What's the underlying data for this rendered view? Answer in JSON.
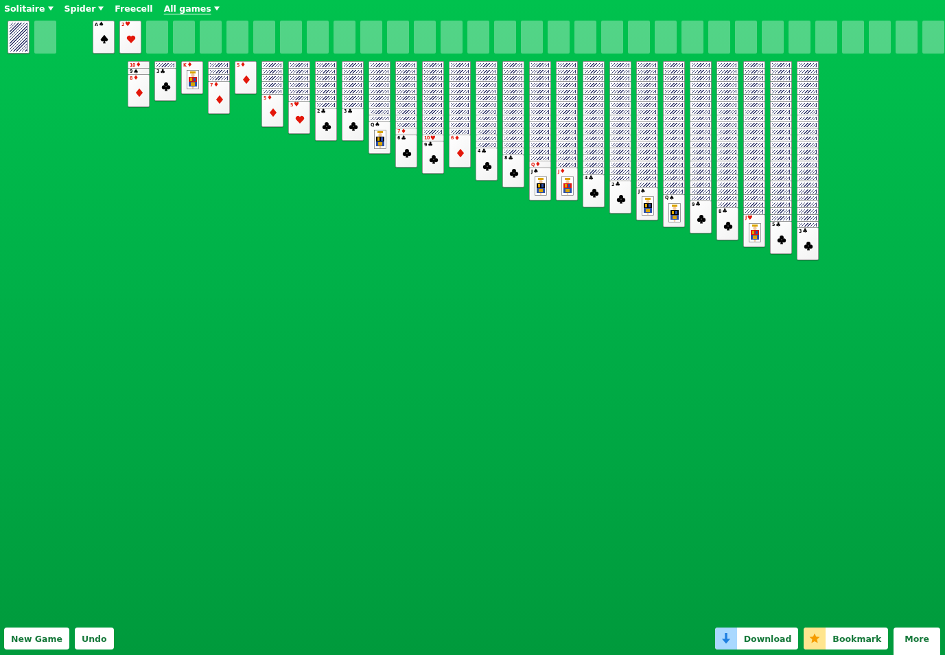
{
  "nav": [
    {
      "label": "Solitaire",
      "has_menu": true,
      "selected": false
    },
    {
      "label": "Spider",
      "has_menu": true,
      "selected": false
    },
    {
      "label": "Freecell",
      "has_menu": false,
      "selected": false
    },
    {
      "label": "All games",
      "has_menu": true,
      "selected": true
    }
  ],
  "stock": [
    {
      "kind": "back"
    },
    {
      "kind": "empty"
    }
  ],
  "foundations": [
    {
      "kind": "spade",
      "rank": "A",
      "suit": "♠",
      "color": "#000000"
    },
    {
      "kind": "heart",
      "rank": "2",
      "suit": "♥",
      "color": "#e3170a"
    },
    {
      "kind": "empty"
    },
    {
      "kind": "empty"
    },
    {
      "kind": "empty"
    },
    {
      "kind": "empty"
    },
    {
      "kind": "empty"
    },
    {
      "kind": "empty"
    },
    {
      "kind": "empty"
    },
    {
      "kind": "empty"
    },
    {
      "kind": "empty"
    },
    {
      "kind": "empty"
    },
    {
      "kind": "empty"
    },
    {
      "kind": "empty"
    },
    {
      "kind": "empty"
    },
    {
      "kind": "empty"
    },
    {
      "kind": "empty"
    },
    {
      "kind": "empty"
    },
    {
      "kind": "empty"
    },
    {
      "kind": "empty"
    },
    {
      "kind": "empty"
    },
    {
      "kind": "empty"
    },
    {
      "kind": "empty"
    },
    {
      "kind": "empty"
    },
    {
      "kind": "empty"
    },
    {
      "kind": "empty"
    },
    {
      "kind": "empty"
    },
    {
      "kind": "empty"
    },
    {
      "kind": "empty"
    },
    {
      "kind": "empty"
    },
    {
      "kind": "empty"
    },
    {
      "kind": "empty"
    }
  ],
  "tableau": [
    {
      "cards": [
        {
          "kind": "diamond",
          "rank": "10",
          "suit": "♦",
          "color": "#e3170a"
        },
        {
          "kind": "spade",
          "rank": "9",
          "suit": "♠",
          "color": "#000000"
        },
        {
          "kind": "diamond",
          "rank": "8",
          "suit": "♦",
          "color": "#e3170a"
        }
      ]
    },
    {
      "cards": [
        {
          "kind": "back"
        },
        {
          "kind": "club",
          "rank": "3",
          "suit": "♣",
          "color": "#000000"
        }
      ]
    },
    {
      "cards": [
        {
          "kind": "court",
          "rank": "K",
          "suit": "♦",
          "color": "#e3170a"
        }
      ]
    },
    {
      "cards": [
        {
          "kind": "back"
        },
        {
          "kind": "back"
        },
        {
          "kind": "back"
        },
        {
          "kind": "diamond",
          "rank": "7",
          "suit": "♦",
          "color": "#e3170a"
        }
      ]
    },
    {
      "cards": [
        {
          "kind": "diamond",
          "rank": "5",
          "suit": "♦",
          "color": "#e3170a"
        }
      ]
    },
    {
      "cards": [
        {
          "kind": "back"
        },
        {
          "kind": "back"
        },
        {
          "kind": "back"
        },
        {
          "kind": "back"
        },
        {
          "kind": "back"
        },
        {
          "kind": "diamond",
          "rank": "5",
          "suit": "♦",
          "color": "#e3170a"
        }
      ]
    },
    {
      "cards": [
        {
          "kind": "back"
        },
        {
          "kind": "back"
        },
        {
          "kind": "back"
        },
        {
          "kind": "back"
        },
        {
          "kind": "back"
        },
        {
          "kind": "back"
        },
        {
          "kind": "heart",
          "rank": "5",
          "suit": "♥",
          "color": "#e3170a"
        }
      ]
    },
    {
      "cards": [
        {
          "kind": "back"
        },
        {
          "kind": "back"
        },
        {
          "kind": "back"
        },
        {
          "kind": "back"
        },
        {
          "kind": "back"
        },
        {
          "kind": "back"
        },
        {
          "kind": "back"
        },
        {
          "kind": "club",
          "rank": "2",
          "suit": "♣",
          "color": "#000000"
        }
      ]
    },
    {
      "cards": [
        {
          "kind": "back"
        },
        {
          "kind": "back"
        },
        {
          "kind": "back"
        },
        {
          "kind": "back"
        },
        {
          "kind": "back"
        },
        {
          "kind": "back"
        },
        {
          "kind": "back"
        },
        {
          "kind": "club",
          "rank": "3",
          "suit": "♣",
          "color": "#000000"
        }
      ]
    },
    {
      "cards": [
        {
          "kind": "back"
        },
        {
          "kind": "back"
        },
        {
          "kind": "back"
        },
        {
          "kind": "back"
        },
        {
          "kind": "back"
        },
        {
          "kind": "back"
        },
        {
          "kind": "back"
        },
        {
          "kind": "back"
        },
        {
          "kind": "back"
        },
        {
          "kind": "court",
          "rank": "Q",
          "suit": "♠",
          "color": "#000000"
        }
      ]
    },
    {
      "cards": [
        {
          "kind": "back"
        },
        {
          "kind": "back"
        },
        {
          "kind": "back"
        },
        {
          "kind": "back"
        },
        {
          "kind": "back"
        },
        {
          "kind": "back"
        },
        {
          "kind": "back"
        },
        {
          "kind": "back"
        },
        {
          "kind": "back"
        },
        {
          "kind": "back"
        },
        {
          "kind": "diamond",
          "rank": "7",
          "suit": "♦",
          "color": "#e3170a"
        },
        {
          "kind": "club",
          "rank": "6",
          "suit": "♣",
          "color": "#000000"
        }
      ]
    },
    {
      "cards": [
        {
          "kind": "back"
        },
        {
          "kind": "back"
        },
        {
          "kind": "back"
        },
        {
          "kind": "back"
        },
        {
          "kind": "back"
        },
        {
          "kind": "back"
        },
        {
          "kind": "back"
        },
        {
          "kind": "back"
        },
        {
          "kind": "back"
        },
        {
          "kind": "back"
        },
        {
          "kind": "back"
        },
        {
          "kind": "heart",
          "rank": "10",
          "suit": "♥",
          "color": "#e3170a"
        },
        {
          "kind": "club",
          "rank": "9",
          "suit": "♣",
          "color": "#000000"
        }
      ]
    },
    {
      "cards": [
        {
          "kind": "back"
        },
        {
          "kind": "back"
        },
        {
          "kind": "back"
        },
        {
          "kind": "back"
        },
        {
          "kind": "back"
        },
        {
          "kind": "back"
        },
        {
          "kind": "back"
        },
        {
          "kind": "back"
        },
        {
          "kind": "back"
        },
        {
          "kind": "back"
        },
        {
          "kind": "back"
        },
        {
          "kind": "diamond",
          "rank": "6",
          "suit": "♦",
          "color": "#e3170a"
        }
      ]
    },
    {
      "cards": [
        {
          "kind": "back"
        },
        {
          "kind": "back"
        },
        {
          "kind": "back"
        },
        {
          "kind": "back"
        },
        {
          "kind": "back"
        },
        {
          "kind": "back"
        },
        {
          "kind": "back"
        },
        {
          "kind": "back"
        },
        {
          "kind": "back"
        },
        {
          "kind": "back"
        },
        {
          "kind": "back"
        },
        {
          "kind": "back"
        },
        {
          "kind": "back"
        },
        {
          "kind": "club",
          "rank": "4",
          "suit": "♣",
          "color": "#000000"
        }
      ]
    },
    {
      "cards": [
        {
          "kind": "back"
        },
        {
          "kind": "back"
        },
        {
          "kind": "back"
        },
        {
          "kind": "back"
        },
        {
          "kind": "back"
        },
        {
          "kind": "back"
        },
        {
          "kind": "back"
        },
        {
          "kind": "back"
        },
        {
          "kind": "back"
        },
        {
          "kind": "back"
        },
        {
          "kind": "back"
        },
        {
          "kind": "back"
        },
        {
          "kind": "back"
        },
        {
          "kind": "back"
        },
        {
          "kind": "club",
          "rank": "8",
          "suit": "♣",
          "color": "#000000"
        }
      ]
    },
    {
      "cards": [
        {
          "kind": "back"
        },
        {
          "kind": "back"
        },
        {
          "kind": "back"
        },
        {
          "kind": "back"
        },
        {
          "kind": "back"
        },
        {
          "kind": "back"
        },
        {
          "kind": "back"
        },
        {
          "kind": "back"
        },
        {
          "kind": "back"
        },
        {
          "kind": "back"
        },
        {
          "kind": "back"
        },
        {
          "kind": "back"
        },
        {
          "kind": "back"
        },
        {
          "kind": "back"
        },
        {
          "kind": "back"
        },
        {
          "kind": "diamond",
          "rank": "Q",
          "suit": "♦",
          "color": "#e3170a"
        },
        {
          "kind": "court",
          "rank": "J",
          "suit": "♠",
          "color": "#000000"
        }
      ]
    },
    {
      "cards": [
        {
          "kind": "back"
        },
        {
          "kind": "back"
        },
        {
          "kind": "back"
        },
        {
          "kind": "back"
        },
        {
          "kind": "back"
        },
        {
          "kind": "back"
        },
        {
          "kind": "back"
        },
        {
          "kind": "back"
        },
        {
          "kind": "back"
        },
        {
          "kind": "back"
        },
        {
          "kind": "back"
        },
        {
          "kind": "back"
        },
        {
          "kind": "back"
        },
        {
          "kind": "back"
        },
        {
          "kind": "back"
        },
        {
          "kind": "back"
        },
        {
          "kind": "court",
          "rank": "J",
          "suit": "♦",
          "color": "#e3170a"
        }
      ]
    },
    {
      "cards": [
        {
          "kind": "back"
        },
        {
          "kind": "back"
        },
        {
          "kind": "back"
        },
        {
          "kind": "back"
        },
        {
          "kind": "back"
        },
        {
          "kind": "back"
        },
        {
          "kind": "back"
        },
        {
          "kind": "back"
        },
        {
          "kind": "back"
        },
        {
          "kind": "back"
        },
        {
          "kind": "back"
        },
        {
          "kind": "back"
        },
        {
          "kind": "back"
        },
        {
          "kind": "back"
        },
        {
          "kind": "back"
        },
        {
          "kind": "back"
        },
        {
          "kind": "back"
        },
        {
          "kind": "club",
          "rank": "4",
          "suit": "♣",
          "color": "#000000"
        }
      ]
    },
    {
      "cards": [
        {
          "kind": "back"
        },
        {
          "kind": "back"
        },
        {
          "kind": "back"
        },
        {
          "kind": "back"
        },
        {
          "kind": "back"
        },
        {
          "kind": "back"
        },
        {
          "kind": "back"
        },
        {
          "kind": "back"
        },
        {
          "kind": "back"
        },
        {
          "kind": "back"
        },
        {
          "kind": "back"
        },
        {
          "kind": "back"
        },
        {
          "kind": "back"
        },
        {
          "kind": "back"
        },
        {
          "kind": "back"
        },
        {
          "kind": "back"
        },
        {
          "kind": "back"
        },
        {
          "kind": "back"
        },
        {
          "kind": "club",
          "rank": "2",
          "suit": "♣",
          "color": "#000000"
        }
      ]
    },
    {
      "cards": [
        {
          "kind": "back"
        },
        {
          "kind": "back"
        },
        {
          "kind": "back"
        },
        {
          "kind": "back"
        },
        {
          "kind": "back"
        },
        {
          "kind": "back"
        },
        {
          "kind": "back"
        },
        {
          "kind": "back"
        },
        {
          "kind": "back"
        },
        {
          "kind": "back"
        },
        {
          "kind": "back"
        },
        {
          "kind": "back"
        },
        {
          "kind": "back"
        },
        {
          "kind": "back"
        },
        {
          "kind": "back"
        },
        {
          "kind": "back"
        },
        {
          "kind": "back"
        },
        {
          "kind": "back"
        },
        {
          "kind": "back"
        },
        {
          "kind": "court",
          "rank": "J",
          "suit": "♠",
          "color": "#000000"
        }
      ]
    },
    {
      "cards": [
        {
          "kind": "back"
        },
        {
          "kind": "back"
        },
        {
          "kind": "back"
        },
        {
          "kind": "back"
        },
        {
          "kind": "back"
        },
        {
          "kind": "back"
        },
        {
          "kind": "back"
        },
        {
          "kind": "back"
        },
        {
          "kind": "back"
        },
        {
          "kind": "back"
        },
        {
          "kind": "back"
        },
        {
          "kind": "back"
        },
        {
          "kind": "back"
        },
        {
          "kind": "back"
        },
        {
          "kind": "back"
        },
        {
          "kind": "back"
        },
        {
          "kind": "back"
        },
        {
          "kind": "back"
        },
        {
          "kind": "back"
        },
        {
          "kind": "back"
        },
        {
          "kind": "court",
          "rank": "Q",
          "suit": "♠",
          "color": "#000000"
        }
      ]
    },
    {
      "cards": [
        {
          "kind": "back"
        },
        {
          "kind": "back"
        },
        {
          "kind": "back"
        },
        {
          "kind": "back"
        },
        {
          "kind": "back"
        },
        {
          "kind": "back"
        },
        {
          "kind": "back"
        },
        {
          "kind": "back"
        },
        {
          "kind": "back"
        },
        {
          "kind": "back"
        },
        {
          "kind": "back"
        },
        {
          "kind": "back"
        },
        {
          "kind": "back"
        },
        {
          "kind": "back"
        },
        {
          "kind": "back"
        },
        {
          "kind": "back"
        },
        {
          "kind": "back"
        },
        {
          "kind": "back"
        },
        {
          "kind": "back"
        },
        {
          "kind": "back"
        },
        {
          "kind": "back"
        },
        {
          "kind": "club",
          "rank": "9",
          "suit": "♣",
          "color": "#000000"
        }
      ]
    },
    {
      "cards": [
        {
          "kind": "back"
        },
        {
          "kind": "back"
        },
        {
          "kind": "back"
        },
        {
          "kind": "back"
        },
        {
          "kind": "back"
        },
        {
          "kind": "back"
        },
        {
          "kind": "back"
        },
        {
          "kind": "back"
        },
        {
          "kind": "back"
        },
        {
          "kind": "back"
        },
        {
          "kind": "back"
        },
        {
          "kind": "back"
        },
        {
          "kind": "back"
        },
        {
          "kind": "back"
        },
        {
          "kind": "back"
        },
        {
          "kind": "back"
        },
        {
          "kind": "back"
        },
        {
          "kind": "back"
        },
        {
          "kind": "back"
        },
        {
          "kind": "back"
        },
        {
          "kind": "back"
        },
        {
          "kind": "back"
        },
        {
          "kind": "club",
          "rank": "8",
          "suit": "♣",
          "color": "#000000"
        }
      ]
    },
    {
      "cards": [
        {
          "kind": "back"
        },
        {
          "kind": "back"
        },
        {
          "kind": "back"
        },
        {
          "kind": "back"
        },
        {
          "kind": "back"
        },
        {
          "kind": "back"
        },
        {
          "kind": "back"
        },
        {
          "kind": "back"
        },
        {
          "kind": "back"
        },
        {
          "kind": "back"
        },
        {
          "kind": "back"
        },
        {
          "kind": "back"
        },
        {
          "kind": "back"
        },
        {
          "kind": "back"
        },
        {
          "kind": "back"
        },
        {
          "kind": "back"
        },
        {
          "kind": "back"
        },
        {
          "kind": "back"
        },
        {
          "kind": "back"
        },
        {
          "kind": "back"
        },
        {
          "kind": "back"
        },
        {
          "kind": "back"
        },
        {
          "kind": "back"
        },
        {
          "kind": "court",
          "rank": "J",
          "suit": "♥",
          "color": "#e3170a"
        }
      ]
    },
    {
      "cards": [
        {
          "kind": "back"
        },
        {
          "kind": "back"
        },
        {
          "kind": "back"
        },
        {
          "kind": "back"
        },
        {
          "kind": "back"
        },
        {
          "kind": "back"
        },
        {
          "kind": "back"
        },
        {
          "kind": "back"
        },
        {
          "kind": "back"
        },
        {
          "kind": "back"
        },
        {
          "kind": "back"
        },
        {
          "kind": "back"
        },
        {
          "kind": "back"
        },
        {
          "kind": "back"
        },
        {
          "kind": "back"
        },
        {
          "kind": "back"
        },
        {
          "kind": "back"
        },
        {
          "kind": "back"
        },
        {
          "kind": "back"
        },
        {
          "kind": "back"
        },
        {
          "kind": "back"
        },
        {
          "kind": "back"
        },
        {
          "kind": "back"
        },
        {
          "kind": "back"
        },
        {
          "kind": "club",
          "rank": "5",
          "suit": "♣",
          "color": "#000000"
        }
      ]
    },
    {
      "cards": [
        {
          "kind": "back"
        },
        {
          "kind": "back"
        },
        {
          "kind": "back"
        },
        {
          "kind": "back"
        },
        {
          "kind": "back"
        },
        {
          "kind": "back"
        },
        {
          "kind": "back"
        },
        {
          "kind": "back"
        },
        {
          "kind": "back"
        },
        {
          "kind": "back"
        },
        {
          "kind": "back"
        },
        {
          "kind": "back"
        },
        {
          "kind": "back"
        },
        {
          "kind": "back"
        },
        {
          "kind": "back"
        },
        {
          "kind": "back"
        },
        {
          "kind": "back"
        },
        {
          "kind": "back"
        },
        {
          "kind": "back"
        },
        {
          "kind": "back"
        },
        {
          "kind": "back"
        },
        {
          "kind": "back"
        },
        {
          "kind": "back"
        },
        {
          "kind": "back"
        },
        {
          "kind": "back"
        },
        {
          "kind": "club",
          "rank": "3",
          "suit": "♣",
          "color": "#000000"
        }
      ]
    }
  ],
  "left_buttons": [
    {
      "label": "New Game"
    },
    {
      "label": "Undo"
    }
  ],
  "right_buttons": [
    {
      "kind": "download",
      "label": "Download"
    },
    {
      "kind": "bookmark",
      "label": "Bookmark"
    },
    {
      "kind": "tab",
      "label": "More"
    }
  ]
}
